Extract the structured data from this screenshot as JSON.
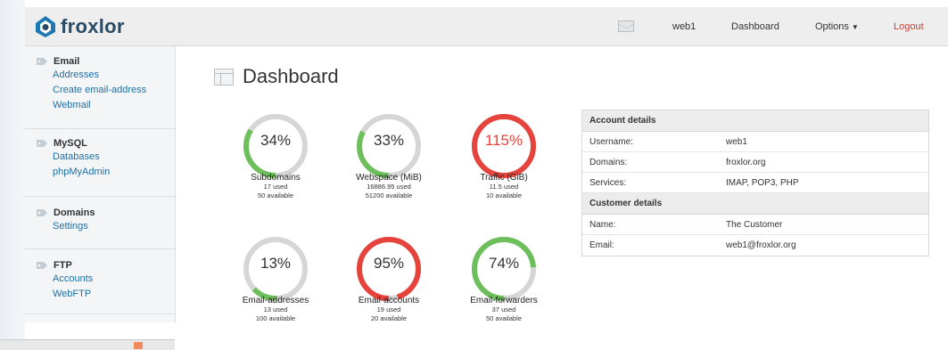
{
  "header": {
    "brand": "froxlor",
    "nav": {
      "user": "web1",
      "dashboard": "Dashboard",
      "options": "Options",
      "logout": "Logout"
    }
  },
  "sidebar": {
    "email": {
      "title": "Email",
      "links": [
        "Addresses",
        "Create email-address",
        "Webmail"
      ]
    },
    "mysql": {
      "title": "MySQL",
      "links": [
        "Databases",
        "phpMyAdmin"
      ]
    },
    "domains": {
      "title": "Domains",
      "links": [
        "Settings"
      ]
    },
    "ftp": {
      "title": "FTP",
      "links": [
        "Accounts",
        "WebFTP"
      ]
    }
  },
  "main": {
    "title": "Dashboard",
    "gauges": [
      {
        "pct": "34%",
        "value": 0.34,
        "name": "Subdomains",
        "used": "17 used",
        "available": "50 available",
        "color": "#6cbf5a",
        "pct_color": "#333333"
      },
      {
        "pct": "33%",
        "value": 0.33,
        "name": "Webspace (MiB)",
        "used": "16886.95 used",
        "available": "51200 available",
        "color": "#6cbf5a",
        "pct_color": "#333333"
      },
      {
        "pct": "115%",
        "value": 1.0,
        "name": "Traffic (GiB)",
        "used": "11.5 used",
        "available": "10 available",
        "color": "#e5433c",
        "pct_color": "#e5433c"
      },
      {
        "pct": "13%",
        "value": 0.13,
        "name": "Email-addresses",
        "used": "13 used",
        "available": "100 available",
        "color": "#6cbf5a",
        "pct_color": "#333333"
      },
      {
        "pct": "95%",
        "value": 0.95,
        "name": "Email-accounts",
        "used": "19 used",
        "available": "20 available",
        "color": "#e5433c",
        "pct_color": "#333333"
      },
      {
        "pct": "74%",
        "value": 0.74,
        "name": "Email-forwarders",
        "used": "37 used",
        "available": "50 available",
        "color": "#6cbf5a",
        "pct_color": "#333333"
      }
    ]
  },
  "account": {
    "header": "Account details",
    "rows": [
      {
        "label": "Username:",
        "value": "web1"
      },
      {
        "label": "Domains:",
        "value": "froxlor.org"
      },
      {
        "label": "Services:",
        "value": "IMAP, POP3, PHP"
      }
    ]
  },
  "customer": {
    "header": "Customer details",
    "rows": [
      {
        "label": "Name:",
        "value": "The Customer"
      },
      {
        "label": "Email:",
        "value": "web1@froxlor.org"
      }
    ]
  },
  "colors": {
    "accent_blue": "#1f6fa5",
    "logout_red": "#e0362b",
    "gauge_track": "#d6d6d6"
  }
}
